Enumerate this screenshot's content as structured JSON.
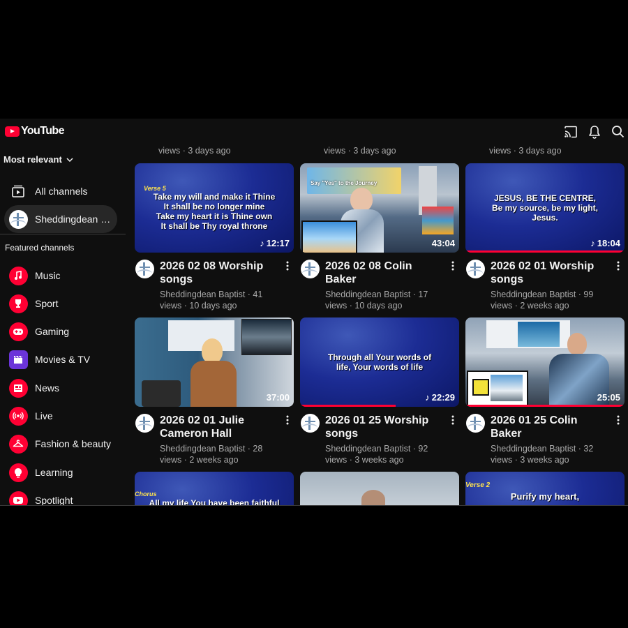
{
  "header": {
    "logo_text": "YouTube"
  },
  "sidebar": {
    "sort_label": "Most relevant",
    "all_channels": "All channels",
    "active_channel": "Sheddingdean Baptist",
    "featured_heading": "Featured channels",
    "categories": [
      {
        "label": "Music",
        "color": "#ff0033"
      },
      {
        "label": "Sport",
        "color": "#ff0033"
      },
      {
        "label": "Gaming",
        "color": "#ff0033"
      },
      {
        "label": "Movies & TV",
        "color": "#6b34d9"
      },
      {
        "label": "News",
        "color": "#ff0033"
      },
      {
        "label": "Live",
        "color": "#ff0033"
      },
      {
        "label": "Fashion & beauty",
        "color": "#ff0033"
      },
      {
        "label": "Learning",
        "color": "#ff0033"
      },
      {
        "label": "Spotlight",
        "color": "#ff0033"
      }
    ]
  },
  "partial_row": [
    {
      "meta": "views · 3 days ago"
    },
    {
      "meta": "views · 3 days ago"
    },
    {
      "meta": "views · 3 days ago"
    }
  ],
  "videos": [
    {
      "title": "2026 02 08 Worship songs",
      "meta1": "Sheddingdean Baptist · 41",
      "meta2": "views · 10 days ago",
      "duration": "12:17",
      "music": true,
      "verse": "Verse 5",
      "lyrics": [
        "Take my will and make it Thine",
        "It shall be no longer mine",
        "Take my heart it is Thine own",
        "It shall be Thy royal throne"
      ],
      "progress": 0
    },
    {
      "title": "2026 02 08 Colin Baker",
      "meta1": "Sheddingdean Baptist · 17",
      "meta2": "views · 10 days ago",
      "duration": "43:04",
      "music": false,
      "slide_text": "Say \"Yes\" to the Journey",
      "progress": 0
    },
    {
      "title": "2026 02 01 Worship songs",
      "meta1": "Sheddingdean Baptist · 99",
      "meta2": "views · 2 weeks ago",
      "duration": "18:04",
      "music": true,
      "verse": "",
      "lyrics": [
        "JESUS, BE THE CENTRE,",
        "Be my source, be my light,",
        "Jesus."
      ],
      "progress": 1
    },
    {
      "title": "2026 02 01 Julie Cameron Hall",
      "meta1": "Sheddingdean Baptist · 28",
      "meta2": "views · 2 weeks ago",
      "duration": "37:00",
      "music": false,
      "progress": 0
    },
    {
      "title": "2026 01 25 Worship songs",
      "meta1": "Sheddingdean Baptist · 92",
      "meta2": "views · 3 weeks ago",
      "duration": "22:29",
      "music": true,
      "verse": "",
      "lyrics": [
        "Through all Your words of",
        "life, Your words of life"
      ],
      "progress": 0.6
    },
    {
      "title": "2026 01 25 Colin Baker",
      "meta1": "Sheddingdean Baptist · 32",
      "meta2": "views · 3 weeks ago",
      "duration": "25:05",
      "music": false,
      "progress": 1
    }
  ],
  "bottom_row": [
    {
      "verse": "Chorus",
      "lyric": "All my life You have been faithful"
    },
    {
      "verse": "",
      "lyric": ""
    },
    {
      "verse": "Verse 2",
      "lyric": "Purify my heart,"
    }
  ]
}
